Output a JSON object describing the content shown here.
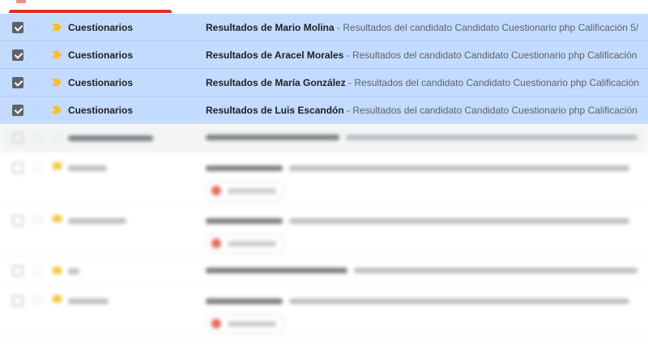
{
  "colors": {
    "selected_bg": "#c2dbff",
    "importance": "#f6c026",
    "tab_accent": "#d93025"
  },
  "icons": {
    "checkbox": "checkbox-checked-icon",
    "star": "star-outline-icon",
    "importance": "importance-marker-icon"
  },
  "selected_rows": [
    {
      "checked": true,
      "sender": "Cuestionarios",
      "subject": "Resultados de Mario Molina",
      "snippet": " - Resultados del candidato Candidato Cuestionario php Calificación 5/"
    },
    {
      "checked": true,
      "sender": "Cuestionarios",
      "subject": "Resultados de Aracel Morales",
      "snippet": " - Resultados del candidato Candidato Cuestionario php Calificación"
    },
    {
      "checked": true,
      "sender": "Cuestionarios",
      "subject": "Resultados de María González",
      "snippet": " - Resultados del candidato Candidato Cuestionario php Calificación"
    },
    {
      "checked": true,
      "sender": "Cuestionarios",
      "subject": "Resultados de Luis Escandón",
      "snippet": " - Resultados del candidato Candidato Cuestionario php Calificación"
    }
  ]
}
